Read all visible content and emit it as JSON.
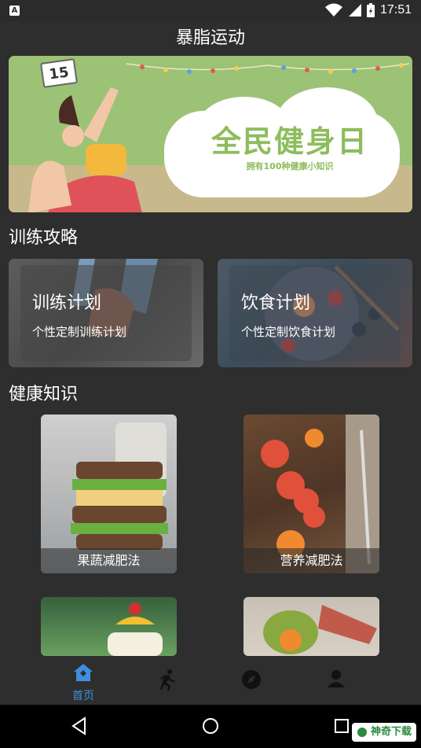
{
  "status_bar": {
    "time": "17:51",
    "notification_icon": "A"
  },
  "app": {
    "title": "暴脂运动"
  },
  "banner": {
    "headline": "全民健身日",
    "subtitle": "拥有100种健康小知识",
    "calendar_number": "15"
  },
  "sections": {
    "training_title": "训练攻略",
    "knowledge_title": "健康知识"
  },
  "plans": [
    {
      "title": "训练计划",
      "desc": "个性定制训练计划"
    },
    {
      "title": "饮食计划",
      "desc": "个性定制饮食计划"
    }
  ],
  "knowledge": [
    {
      "label": "果蔬减肥法"
    },
    {
      "label": "营养减肥法"
    }
  ],
  "bottom_nav": {
    "items": [
      {
        "label": "首页",
        "icon": "home-icon",
        "active": true
      },
      {
        "icon": "running-icon"
      },
      {
        "icon": "compass-icon"
      },
      {
        "icon": "profile-icon"
      }
    ],
    "active_color": "#3d8fe0"
  },
  "watermark": {
    "text": "神奇下载"
  }
}
